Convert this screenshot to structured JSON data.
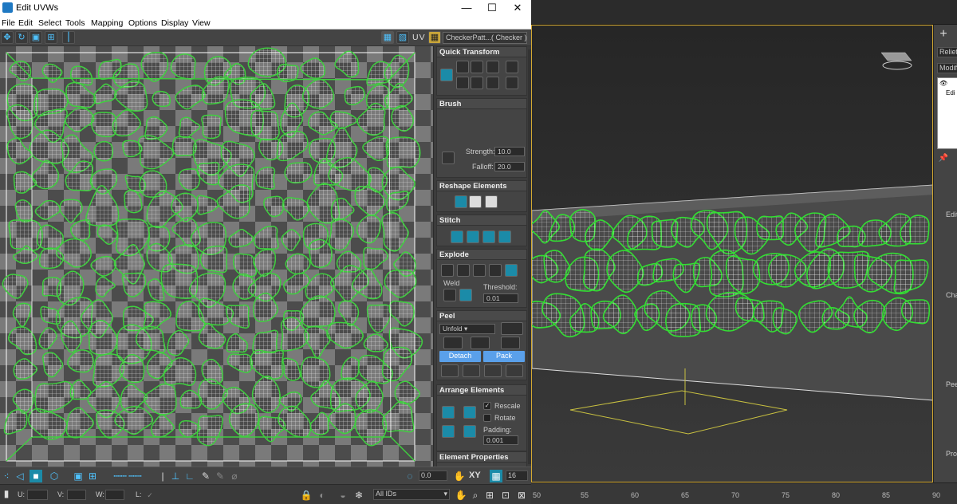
{
  "window": {
    "title": "Edit UVWs",
    "minimize": "—",
    "maximize": "☐",
    "close": "✕"
  },
  "menu": [
    "File",
    "Edit",
    "Select",
    "Tools",
    "Mapping",
    "Options",
    "Display",
    "View"
  ],
  "toolbar": {
    "uv_label": "UV",
    "checker_dropdown": "CheckerPatt...( Checker )"
  },
  "panel": {
    "quick_transform": "Quick Transform",
    "brush": {
      "title": "Brush",
      "strength_label": "Strength:",
      "strength_value": "10.0",
      "falloff_label": "Falloff:",
      "falloff_value": "20.0"
    },
    "reshape": "Reshape Elements",
    "stitch": "Stitch",
    "explode": {
      "title": "Explode",
      "weld_label": "Weld",
      "threshold_label": "Threshold:",
      "threshold_value": "0.01"
    },
    "peel": {
      "title": "Peel",
      "mode": "Unfold",
      "detach": "Detach",
      "pack": "Pack"
    },
    "arrange": {
      "title": "Arrange Elements",
      "rescale": "Rescale",
      "rotate": "Rotate",
      "padding_label": "Padding:",
      "padding_value": "0.001"
    },
    "element_properties": "Element Properties"
  },
  "bottom": {
    "u_label": "U:",
    "v_label": "V:",
    "w_label": "W:",
    "l_label": "L:",
    "angle_value": "0.0",
    "xy_label": "XY",
    "grid_value": "16",
    "ids_dropdown": "All IDs"
  },
  "timeline": {
    "ticks": [
      "50",
      "55",
      "60",
      "65",
      "70",
      "75",
      "80",
      "85",
      "90"
    ]
  },
  "command_panel": {
    "tab_label": "Relief_",
    "modifier_label": "Modifie",
    "stack_label": "Edi",
    "sections": [
      "Edit",
      "Cha",
      "Pee",
      "Pro"
    ]
  }
}
